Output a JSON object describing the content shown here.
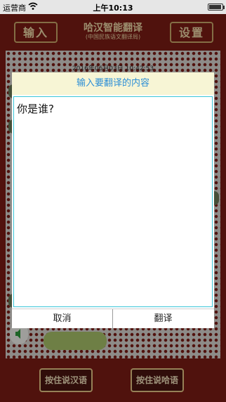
{
  "status_bar": {
    "carrier": "运营商",
    "time": "上午10:13",
    "battery_level": 0.95
  },
  "header": {
    "input_button": "输入",
    "title": "哈汉智能翻译",
    "subtitle": "(中国民族语文翻译局)",
    "settings_button": "设置"
  },
  "conversation": {
    "timestamp": "2016年06月03日 10:42:53"
  },
  "dialog": {
    "title": "输入要翻译的内容",
    "input_text": "你是谁?",
    "cancel_label": "取消",
    "translate_label": "翻译"
  },
  "footer": {
    "hold_chinese": "按住说汉语",
    "hold_kazakh": "按住说哈语"
  },
  "colors": {
    "primary_red": "#7c1c15",
    "gold": "#efd9a8",
    "dialog_title_text": "#2d8fd6",
    "input_border": "#39c6d8"
  },
  "icons": [
    "wifi-icon",
    "battery-icon",
    "speaker-icon"
  ]
}
